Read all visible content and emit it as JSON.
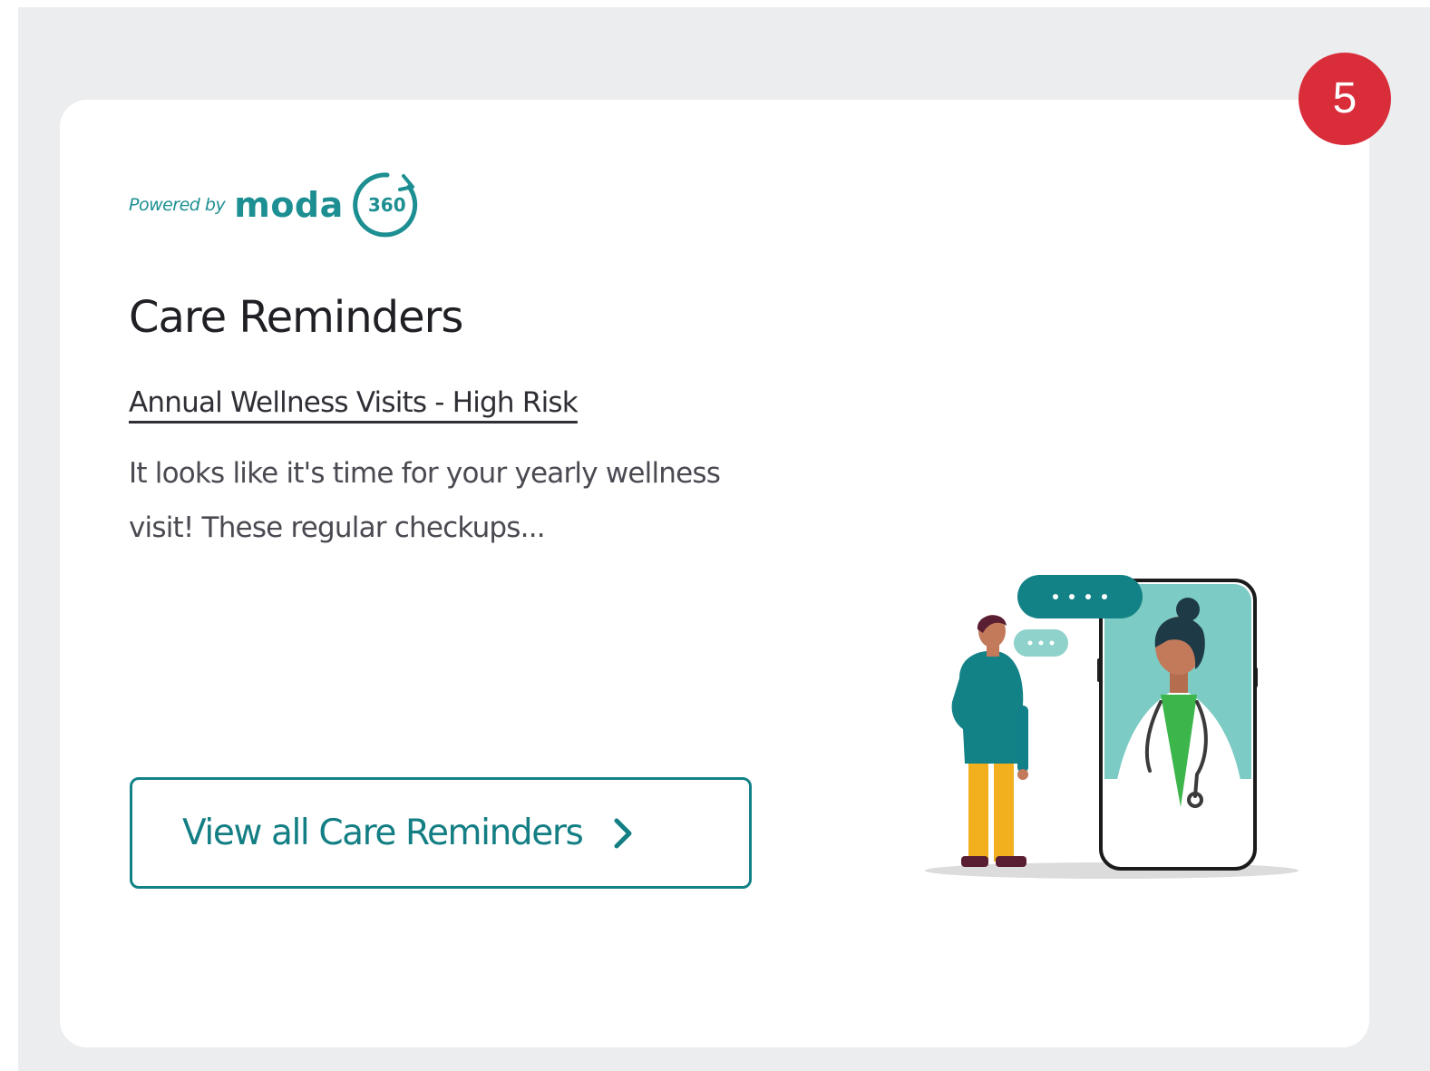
{
  "badge": {
    "count": "5"
  },
  "powered_by": {
    "prefix": "Powered by",
    "brand": "moda",
    "mark": "360"
  },
  "card": {
    "title": "Care Reminders",
    "item_title": "Annual Wellness Visits - High Risk",
    "item_description": "It looks like it's time for your yearly wellness visit! These regular checkups...",
    "cta_label": "View all Care Reminders"
  },
  "icons": {
    "cta": "chevron-right-icon",
    "illustration": "telehealth-doctor-illustration"
  },
  "colors": {
    "accent": "#138287",
    "badge": "#d92d3a",
    "panel_bg": "#ecedef",
    "card_bg": "#ffffff"
  }
}
